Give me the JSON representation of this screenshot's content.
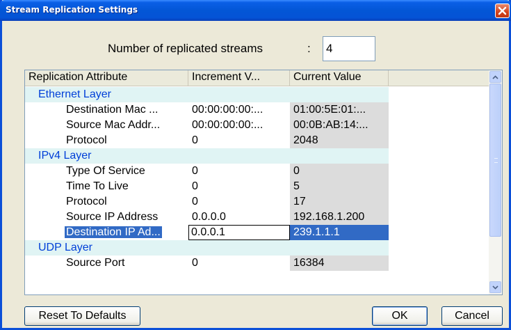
{
  "window": {
    "title": "Stream Replication Settings"
  },
  "streams": {
    "label": "Number of replicated streams",
    "colon": ":",
    "value": "4"
  },
  "table": {
    "headers": [
      "Replication Attribute",
      "Increment V...",
      "Current Value"
    ],
    "rows": [
      {
        "type": "layer",
        "attribute": "Ethernet Layer",
        "increment": "",
        "current": ""
      },
      {
        "type": "attr",
        "attribute": "Destination Mac ...",
        "increment": "00:00:00:00:...",
        "current": "01:00:5E:01:..."
      },
      {
        "type": "attr",
        "attribute": "Source Mac Addr...",
        "increment": "00:00:00:00:...",
        "current": "00:0B:AB:14:..."
      },
      {
        "type": "attr",
        "attribute": "Protocol",
        "increment": "0",
        "current": "2048"
      },
      {
        "type": "layer",
        "attribute": "IPv4 Layer",
        "increment": "",
        "current": ""
      },
      {
        "type": "attr",
        "attribute": "Type Of Service",
        "increment": "0",
        "current": "0"
      },
      {
        "type": "attr",
        "attribute": "Time To Live",
        "increment": "0",
        "current": "5"
      },
      {
        "type": "attr",
        "attribute": "Protocol",
        "increment": "0",
        "current": "17"
      },
      {
        "type": "attr",
        "attribute": "Source IP Address",
        "increment": "0.0.0.0",
        "current": "192.168.1.200"
      },
      {
        "type": "sel",
        "attribute": "Destination IP Ad...",
        "increment": "0.0.0.1",
        "current": "239.1.1.1"
      },
      {
        "type": "layer",
        "attribute": "UDP Layer",
        "increment": "",
        "current": ""
      },
      {
        "type": "attr",
        "attribute": "Source Port",
        "increment": "0",
        "current": "16384"
      }
    ]
  },
  "buttons": {
    "reset": "Reset To Defaults",
    "ok": "OK",
    "cancel": "Cancel"
  },
  "colors": {
    "titlebar": "#0356d6",
    "selection": "#316ac5",
    "layer_text": "#003fd8",
    "layer_bg": "#e0f4f4"
  }
}
